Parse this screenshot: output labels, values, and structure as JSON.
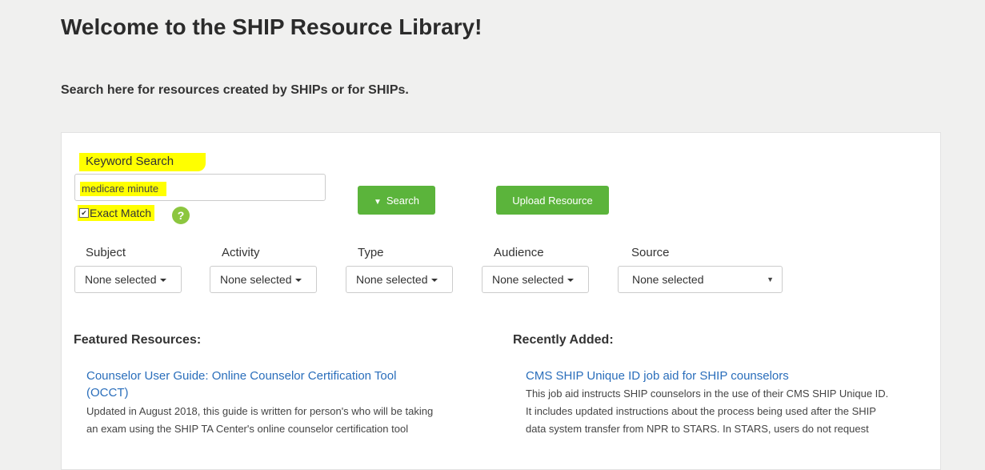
{
  "header": {
    "title": "Welcome to the SHIP Resource Library!",
    "subtitle": "Search here for resources created by SHIPs or for SHIPs."
  },
  "search": {
    "keyword_label": "Keyword Search",
    "keyword_value": "medicare minute",
    "exact_match_label": "Exact Match",
    "exact_match_checked": true,
    "help_symbol": "?",
    "search_button_label": "Search",
    "upload_button_label": "Upload Resource"
  },
  "filters": [
    {
      "label": "Subject",
      "value": "None selected"
    },
    {
      "label": "Activity",
      "value": "None selected"
    },
    {
      "label": "Type",
      "value": "None selected"
    },
    {
      "label": "Audience",
      "value": "None selected"
    },
    {
      "label": "Source",
      "value": "None selected"
    }
  ],
  "featured": {
    "heading": "Featured Resources:",
    "item_title_line1": "Counselor User Guide: Online Counselor Certification Tool",
    "item_title_line2": "(OCCT)",
    "item_desc_line1": "Updated in August 2018, this guide is written for person's who will be taking",
    "item_desc_line2": "an exam using the SHIP TA Center's online counselor certification tool"
  },
  "recent": {
    "heading": "Recently Added:",
    "item_title": "CMS SHIP Unique ID job aid for SHIP counselors",
    "item_desc_line1": "This job aid instructs SHIP counselors in the use of their CMS SHIP Unique ID.",
    "item_desc_line2": "It includes updated instructions about the process being used after the SHIP",
    "item_desc_line3": "data system transfer from NPR to STARS. In STARS, users do not request"
  },
  "colors": {
    "accent_green": "#5bb43b",
    "link_blue": "#2a6ebb",
    "highlight": "#ffff00"
  }
}
